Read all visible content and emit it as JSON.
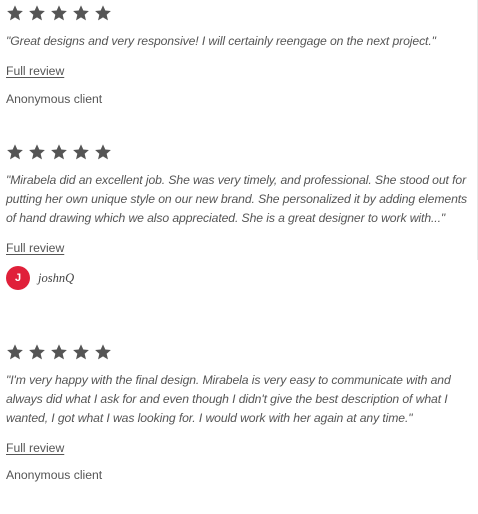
{
  "reviews": [
    {
      "rating": 5,
      "quote": "\"Great designs and very responsive! I will certainly reengage on the next project.\"",
      "link_label": "Full review",
      "client": "Anonymous client"
    },
    {
      "rating": 5,
      "quote": "\"Mirabela did an excellent job. She was very timely, and professional. She stood out for putting her own unique style on our new brand. She personalized it by adding elements of hand drawing which we also appreciated. She is a great designer to work with...\"",
      "link_label": "Full review",
      "avatar_initial": "J",
      "username": "joshnQ"
    },
    {
      "rating": 5,
      "quote": "\"I'm very happy with the final design. Mirabela is very easy to communicate with and always did what I ask for and even though I didn't give the best description of what I wanted, I got what I was looking for. I would work with her again at any time.\"",
      "link_label": "Full review",
      "client": "Anonymous client"
    }
  ],
  "colors": {
    "star": "#555555",
    "avatar": "#e0203a",
    "text": "#555555"
  },
  "icons": {
    "star": "star-icon"
  }
}
